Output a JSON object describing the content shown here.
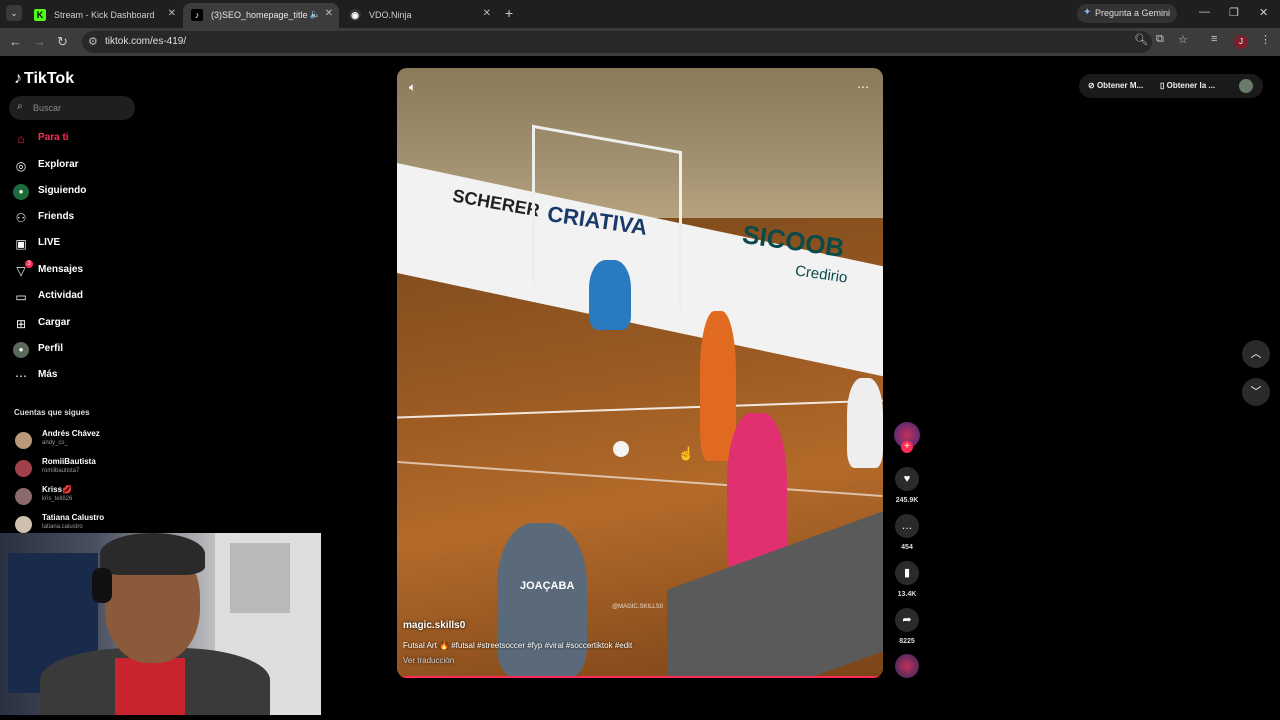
{
  "browser": {
    "tabs": [
      {
        "title": "Stream - Kick Dashboard",
        "favicon": "K",
        "favicon_color": "#53fc18"
      },
      {
        "title": "(3)SEO_homepage_title",
        "favicon": "♪",
        "favicon_color": "#000000"
      },
      {
        "title": "VDO.Ninja",
        "favicon": "◉",
        "favicon_color": "#ffffff"
      }
    ],
    "gemini_label": "Pregunta a Gemini",
    "url": "tiktok.com/es-419/",
    "profile_initial": "J"
  },
  "sidebar": {
    "logo": "TikTok",
    "search_placeholder": "Buscar",
    "nav": [
      {
        "label": "Para ti",
        "icon": "home-icon"
      },
      {
        "label": "Explorar",
        "icon": "compass-icon"
      },
      {
        "label": "Siguiendo",
        "icon": "following-avatar-icon"
      },
      {
        "label": "Friends",
        "icon": "friends-icon"
      },
      {
        "label": "LIVE",
        "icon": "live-icon"
      },
      {
        "label": "Mensajes",
        "icon": "messages-icon",
        "badge": "3"
      },
      {
        "label": "Actividad",
        "icon": "activity-icon"
      },
      {
        "label": "Cargar",
        "icon": "upload-icon"
      },
      {
        "label": "Perfil",
        "icon": "profile-icon"
      },
      {
        "label": "Más",
        "icon": "more-icon"
      }
    ],
    "following_title": "Cuentas que sigues",
    "accounts": [
      {
        "name": "Andrés Chávez",
        "handle": "andy_cs_",
        "color": "#b89a7a"
      },
      {
        "name": "RomiiBautista",
        "handle": "romiibautista7",
        "color": "#a0404a"
      },
      {
        "name": "Kriss💋",
        "handle": "kris_tell826",
        "color": "#8a6a6a"
      },
      {
        "name": "Tatiana Calustro",
        "handle": "tatiana.calustro",
        "color": "#d0c0b0"
      }
    ]
  },
  "video": {
    "username": "magic.skills0",
    "description": "Futsal Art 🔥 #futsal #streetsoccer #fyp #viral #soccertiktok #edit",
    "translate": "Ver traducción",
    "watermark": "@MAGIC.SKILLS0",
    "banners": [
      "SCHERER",
      "CRIATIVA",
      "SICOOB",
      "Credirio",
      "JOAÇABA"
    ]
  },
  "actions": {
    "likes": "245.9K",
    "comments": "454",
    "saves": "13.4K",
    "shares": "8225"
  },
  "topright": {
    "pill1": "Obtener M...",
    "pill2": "Obtener la ..."
  }
}
